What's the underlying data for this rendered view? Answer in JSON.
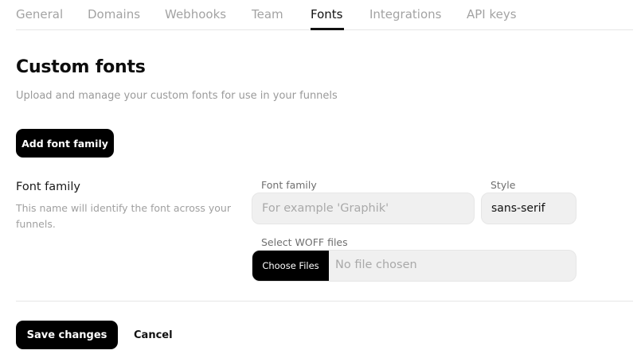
{
  "tabs": [
    {
      "label": "General"
    },
    {
      "label": "Domains"
    },
    {
      "label": "Webhooks"
    },
    {
      "label": "Team"
    },
    {
      "label": "Fonts"
    },
    {
      "label": "Integrations"
    },
    {
      "label": "API keys"
    }
  ],
  "active_tab": "Fonts",
  "page": {
    "title": "Custom fonts",
    "subtitle": "Upload and manage your custom fonts for use in your funnels"
  },
  "add_button_label": "Add font family",
  "font_family_section": {
    "title": "Font family",
    "description": "This name will identify the font across your funnels."
  },
  "form": {
    "family_label": "Font family",
    "family_placeholder": "For example 'Graphik'",
    "family_value": "",
    "style_label": "Style",
    "style_value": "sans-serif",
    "woff_label": "Select WOFF files",
    "choose_files_label": "Choose Files",
    "file_status": "No file chosen"
  },
  "footer": {
    "save_label": "Save changes",
    "cancel_label": "Cancel"
  },
  "colors": {
    "accent": "#000000",
    "active_tab_text": "#111111",
    "inactive_tab_text": "#a3a3a3",
    "input_background": "#f0f0f0",
    "muted_text": "#9a9a9a"
  }
}
